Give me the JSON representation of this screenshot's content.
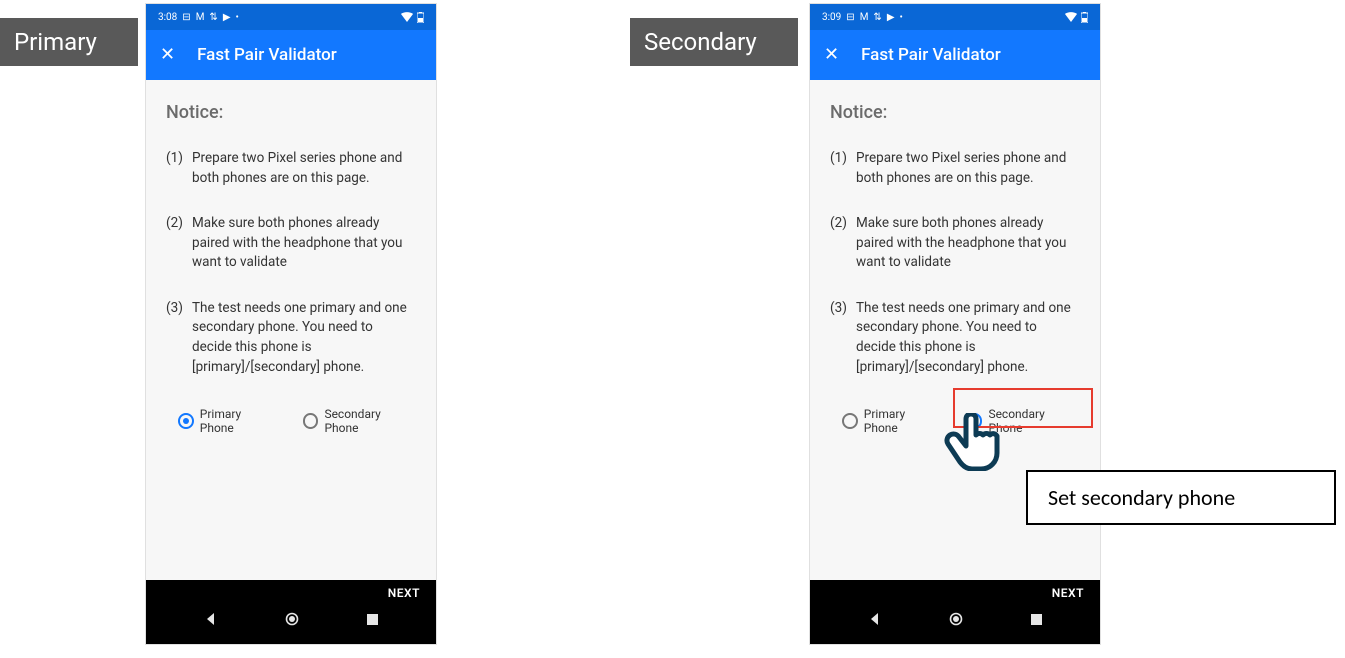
{
  "tags": {
    "primary": "Primary",
    "secondary": "Secondary"
  },
  "phones": {
    "left": {
      "time": "3:08",
      "appTitle": "Fast Pair Validator",
      "notice": "Notice:",
      "steps": [
        {
          "num": "(1)",
          "txt": "Prepare two Pixel series phone and both phones are on this page."
        },
        {
          "num": "(2)",
          "txt": "Make sure both phones already paired with the headphone that you want to validate"
        },
        {
          "num": "(3)",
          "txt": "The test needs one primary and one secondary phone. You need to decide this phone is [primary]/[secondary] phone."
        }
      ],
      "radioPrimary": "Primary Phone",
      "radioSecondary": "Secondary Phone",
      "next": "NEXT"
    },
    "right": {
      "time": "3:09",
      "appTitle": "Fast Pair Validator",
      "notice": "Notice:",
      "steps": [
        {
          "num": "(1)",
          "txt": "Prepare two Pixel series phone and both phones are on this page."
        },
        {
          "num": "(2)",
          "txt": "Make sure both phones already paired with the headphone that you want to validate"
        },
        {
          "num": "(3)",
          "txt": "The test needs one primary and one secondary phone. You need to decide this phone is [primary]/[secondary] phone."
        }
      ],
      "radioPrimary": "Primary Phone",
      "radioSecondary": "Secondary Phone",
      "next": "NEXT"
    }
  },
  "callout": "Set secondary phone"
}
